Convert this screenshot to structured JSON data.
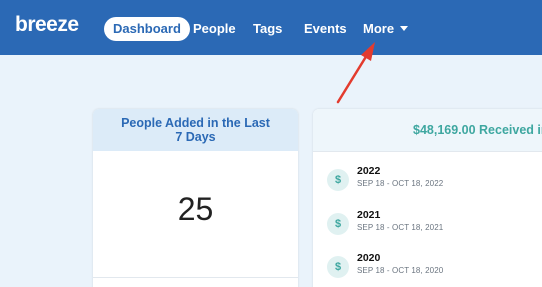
{
  "app": {
    "logo_text": "breeze"
  },
  "nav": {
    "items": [
      {
        "label": "Dashboard",
        "active": true
      },
      {
        "label": "People"
      },
      {
        "label": "Tags"
      },
      {
        "label": "Events"
      },
      {
        "label": "More"
      }
    ]
  },
  "people_card": {
    "title_line1": "People Added in the Last",
    "title_line2": "7 Days",
    "count": "25"
  },
  "income_card": {
    "title": "$48,169.00 Received in",
    "rows": [
      {
        "icon": "$",
        "year": "2022",
        "range": "SEP 18 - OCT 18, 2022"
      },
      {
        "icon": "$",
        "year": "2021",
        "range": "SEP 18 - OCT 18, 2021"
      },
      {
        "icon": "$",
        "year": "2020",
        "range": "SEP 18 - OCT 18, 2020"
      }
    ]
  },
  "colors": {
    "navbar": "#2b69b5",
    "page_background": "#eaf3fb",
    "annotation_arrow": "#e33b2e",
    "teal_accent": "#3ea7a0"
  },
  "icons": {
    "row_icon": "dollar-icon",
    "more_caret": "chevron-down-icon"
  }
}
